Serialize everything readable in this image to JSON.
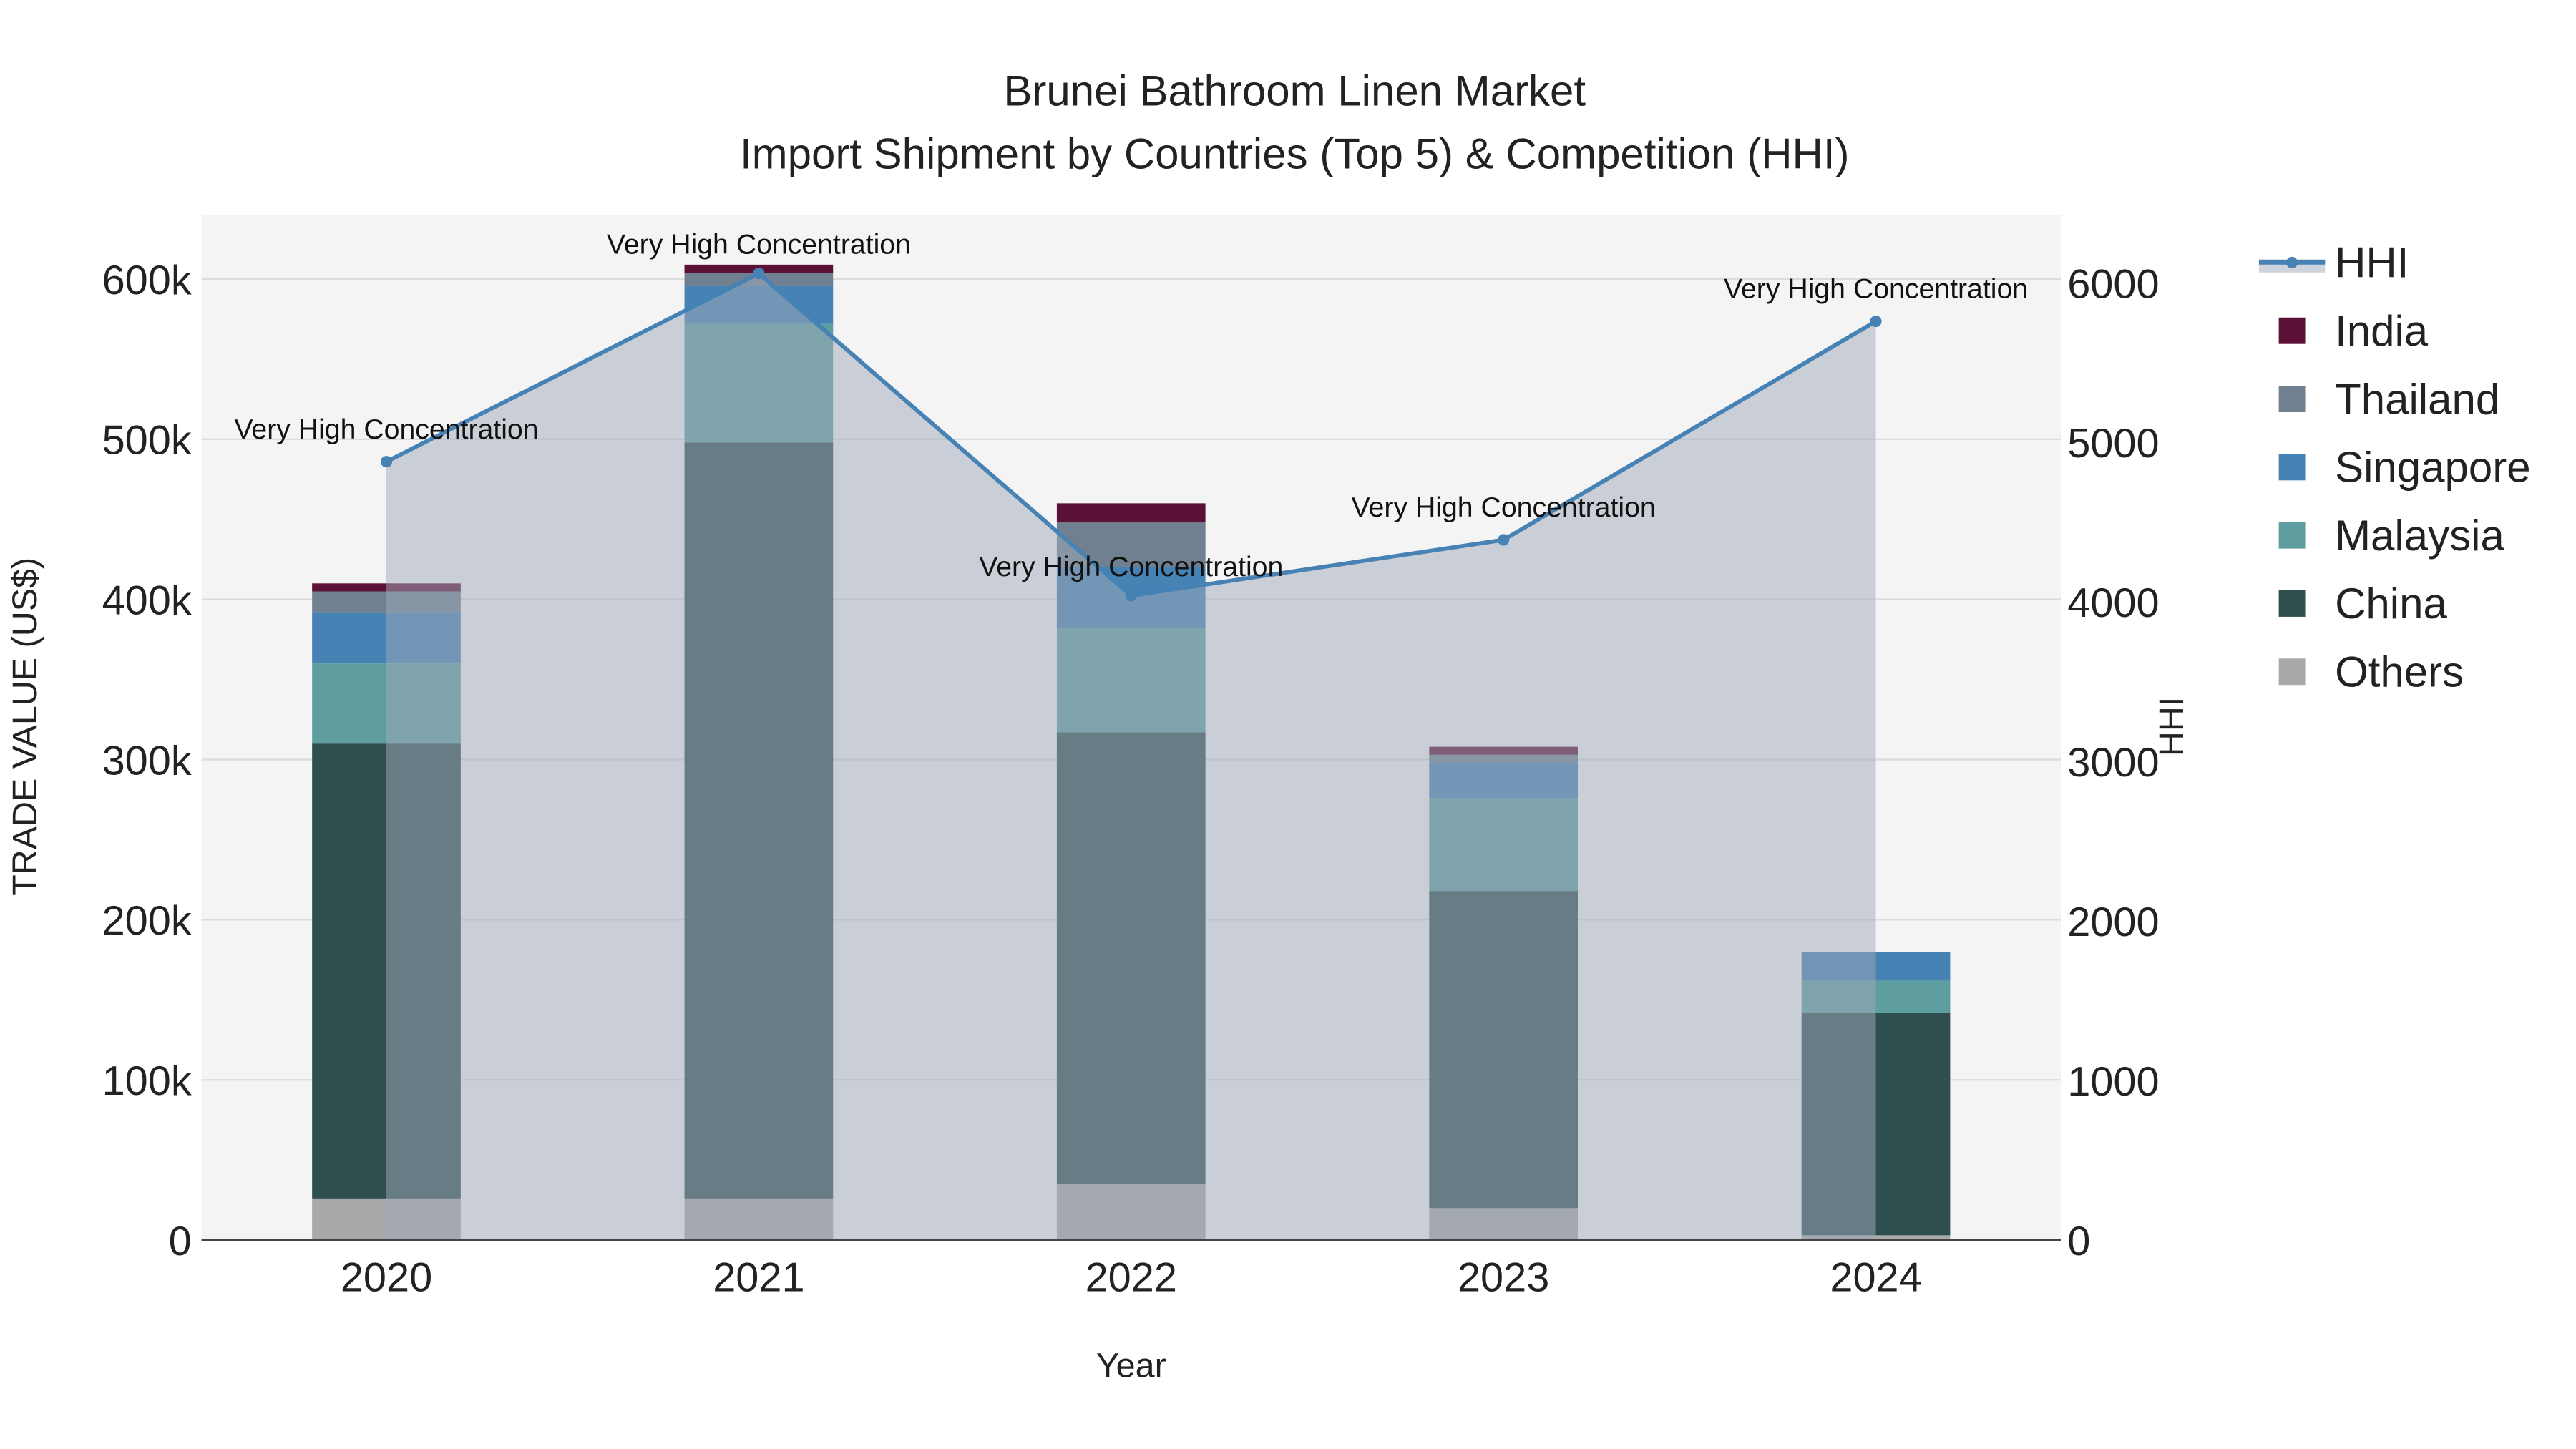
{
  "chart_data": {
    "type": "bar",
    "title_line1": "Brunei Bathroom Linen Market",
    "title_line2": "Import Shipment by Countries (Top 5) & Competition (HHI)",
    "xlabel": "Year",
    "ylabel": "TRADE VALUE (US$)",
    "y2label": "HHI",
    "categories": [
      "2020",
      "2021",
      "2022",
      "2023",
      "2024"
    ],
    "ylim": [
      0,
      640000
    ],
    "y2lim": [
      0,
      6420
    ],
    "yticks": [
      0,
      100000,
      200000,
      300000,
      400000,
      500000,
      600000
    ],
    "ytick_labels": [
      "0",
      "100k",
      "200k",
      "300k",
      "400k",
      "500k",
      "600k"
    ],
    "y2ticks": [
      0,
      1000,
      2000,
      3000,
      4000,
      5000,
      6000
    ],
    "y2tick_labels": [
      "0",
      "1000",
      "2000",
      "3000",
      "4000",
      "5000",
      "6000"
    ],
    "grid": true,
    "legend_position": "right",
    "series": [
      {
        "name": "Others",
        "color": "#a9a9a9",
        "values": [
          26000,
          26000,
          35000,
          20000,
          3000
        ]
      },
      {
        "name": "China",
        "color": "#2f4f4f",
        "values": [
          284000,
          472000,
          282000,
          198000,
          139000
        ]
      },
      {
        "name": "Malaysia",
        "color": "#5f9ea0",
        "values": [
          50000,
          74000,
          65000,
          58000,
          20000
        ]
      },
      {
        "name": "Singapore",
        "color": "#4682b4",
        "values": [
          32000,
          24000,
          38000,
          22000,
          18000
        ]
      },
      {
        "name": "Thailand",
        "color": "#708090",
        "values": [
          13000,
          8000,
          28000,
          5000,
          0
        ]
      },
      {
        "name": "India",
        "color": "#5c1236",
        "values": [
          5000,
          5000,
          12000,
          5000,
          0
        ]
      }
    ],
    "hhi": {
      "name": "HHI",
      "color": "#4682b4",
      "values": [
        4880,
        6060,
        4040,
        4390,
        5760
      ],
      "annotations": [
        "Very High Concentration",
        "Very High Concentration",
        "Very High Concentration",
        "Very High Concentration",
        "Very High Concentration"
      ]
    },
    "legend_order": [
      "HHI",
      "India",
      "Thailand",
      "Singapore",
      "Malaysia",
      "China",
      "Others"
    ]
  }
}
